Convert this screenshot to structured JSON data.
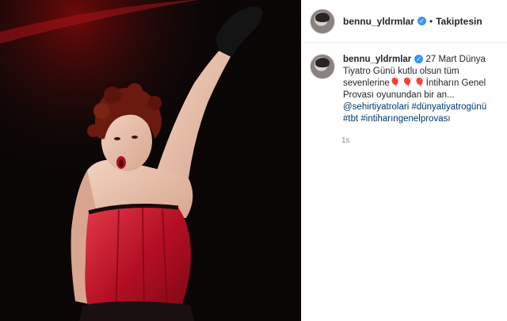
{
  "post": {
    "username": "bennu_yldrmlar",
    "follow_status": "Takiptesin",
    "separator": "•",
    "caption_text_1": "27 Mart Dünya Tiyatro Günü kutlu olsun tüm sevenlerine",
    "caption_hearts": "🎈🎈🎈",
    "caption_text_2": "İntiharın Genel Provası oyunundan bir an...",
    "mention": "@sehirtiyatrolari",
    "hashtags": [
      "#dünyatiyatrogünü",
      "#tbt",
      "#intiharıngenelprovası"
    ],
    "timestamp": "1s"
  },
  "icons": {
    "verified": "verified-badge-icon",
    "avatar": "profile-avatar"
  },
  "colors": {
    "link": "#00376b",
    "verified": "#3897f0",
    "photo_background": "#0a0a0a",
    "corset": "#c8102e"
  }
}
